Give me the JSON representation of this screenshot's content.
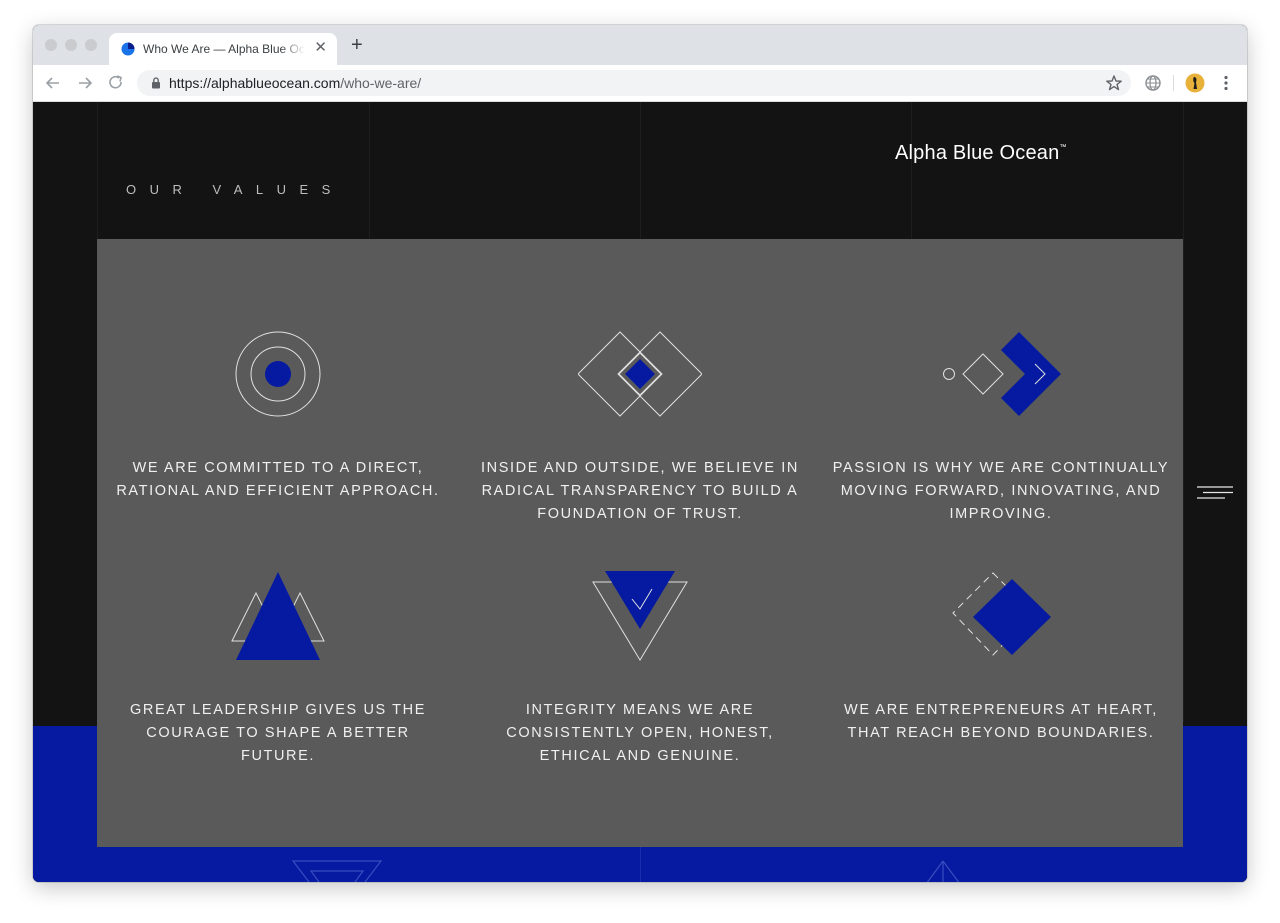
{
  "browser": {
    "tab_title": "Who We Are — Alpha Blue Ocean",
    "tab_close": "✕",
    "new_tab": "+",
    "url_host": "https://alphablueocean.com",
    "url_path": "/who-we-are/"
  },
  "site": {
    "brand": "Alpha Blue Ocean",
    "trademark": "™",
    "section_title": "OUR VALUES"
  },
  "values": [
    {
      "icon": "target-circle-icon",
      "text": "WE ARE COMMITTED TO A DIRECT, RATIONAL AND EFFICIENT APPROACH."
    },
    {
      "icon": "overlapping-diamonds-icon",
      "text": "INSIDE AND OUTSIDE, WE BELIEVE IN RADICAL TRANSPARENCY TO BUILD A FOUNDATION OF TRUST."
    },
    {
      "icon": "forward-chevron-icon",
      "text": "PASSION IS WHY WE ARE CONTINUALLY MOVING FORWARD, INNOVATING, AND IMPROVING."
    },
    {
      "icon": "triangles-icon",
      "text": "GREAT LEADERSHIP GIVES US THE COURAGE TO SHAPE A BETTER FUTURE."
    },
    {
      "icon": "inverted-triangle-check-icon",
      "text": "INTEGRITY MEANS WE ARE CONSISTENTLY OPEN, HONEST, ETHICAL AND GENUINE."
    },
    {
      "icon": "dashed-diamond-icon",
      "text": "WE ARE ENTREPRENEURS AT HEART, THAT REACH BEYOND BOUNDARIES."
    }
  ],
  "colors": {
    "accent_blue": "#051aa0",
    "card_gray": "#5a5a5a",
    "page_black": "#131313"
  }
}
